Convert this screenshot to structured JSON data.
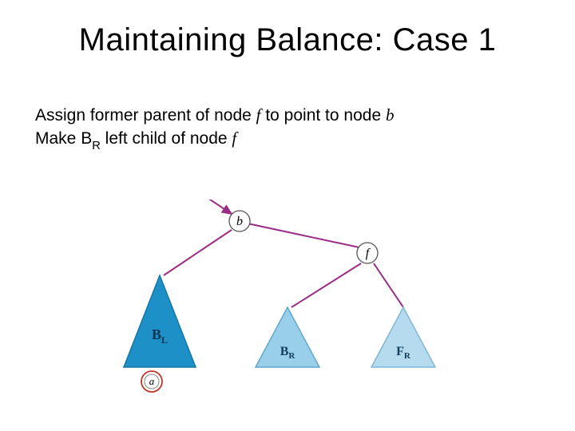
{
  "title": "Maintaining Balance: Case 1",
  "line1_pre": "Assign former parent of node ",
  "line1_var1": "f",
  "line1_mid": "  to point to node ",
  "line1_var2": "b",
  "line2_pre": "Make ",
  "line2_var": "B",
  "line2_sub": "R",
  "line2_post": " left child of node ",
  "line2_var2": "f",
  "diagram": {
    "nodes": {
      "b": "b",
      "f": "f",
      "a": "a"
    },
    "subtrees": {
      "BL": {
        "base": "B",
        "sub": "L"
      },
      "BR": {
        "base": "B",
        "sub": "R"
      },
      "FR": {
        "base": "F",
        "sub": "R"
      }
    },
    "colors": {
      "BL_fill": "#1e90c8",
      "BL_stroke": "#1276a8",
      "BR_fill": "#99cfe8",
      "BR_stroke": "#5fa9cc",
      "FR_fill": "#b6daee",
      "FR_stroke": "#7fb8d6",
      "node_fill": "#ffffff",
      "node_stroke": "#555555",
      "a_stroke": "#c0392b",
      "edge": "#9b2d86",
      "incoming": "#9b2d86"
    }
  }
}
